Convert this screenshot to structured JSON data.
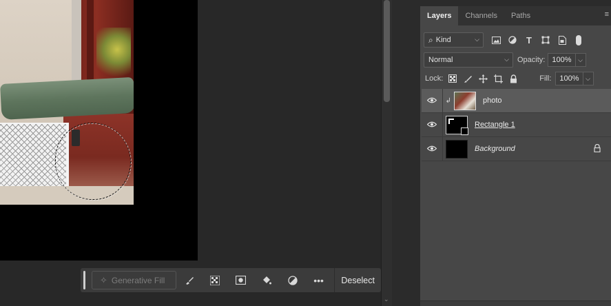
{
  "panel": {
    "tabs": [
      {
        "label": "Layers",
        "active": true
      },
      {
        "label": "Channels",
        "active": false
      },
      {
        "label": "Paths",
        "active": false
      }
    ],
    "filter": {
      "kind_label": "Kind",
      "icons": [
        "image-filter-icon",
        "adjustment-filter-icon",
        "type-filter-icon",
        "shape-filter-icon",
        "smart-object-filter-icon"
      ]
    },
    "blend_mode": "Normal",
    "opacity_label": "Opacity:",
    "opacity_value": "100%",
    "lock_label": "Lock:",
    "fill_label": "Fill:",
    "fill_value": "100%",
    "layers": [
      {
        "name": "photo",
        "selected": true,
        "clipped": true,
        "thumb": "photo"
      },
      {
        "name": "Rectangle 1",
        "selected": false,
        "clipped": false,
        "thumb": "rect"
      },
      {
        "name": "Background",
        "selected": false,
        "clipped": false,
        "thumb": "black",
        "locked": true
      }
    ]
  },
  "taskbar": {
    "generative_fill_label": "Generative Fill",
    "deselect_label": "Deselect",
    "icons": [
      "brush-icon",
      "checker-icon",
      "mask-icon",
      "paint-bucket-icon",
      "half-circle-icon",
      "more-icon"
    ]
  },
  "colors": {
    "canvas_bg": "#282828",
    "panel_bg": "#474747",
    "selected_layer": "#5b5b5b"
  }
}
